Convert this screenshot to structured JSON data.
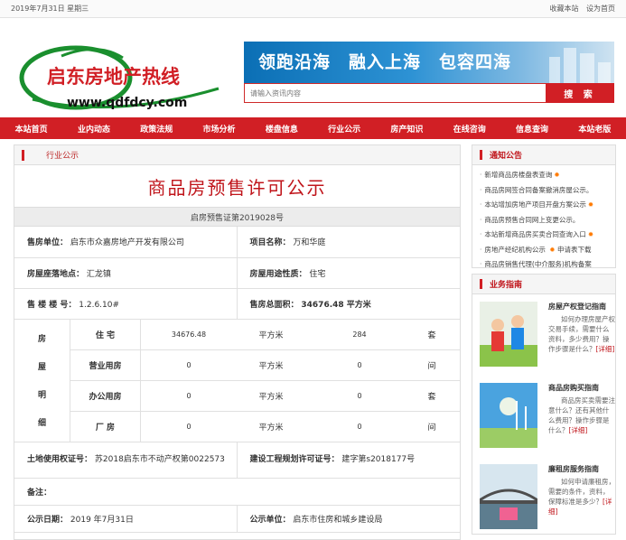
{
  "topbar": {
    "date": "2019年7月31日 星期三",
    "bookmark": "收藏本站",
    "homepage": "设为首页"
  },
  "header": {
    "logo_name": "启东房地产热线",
    "logo_url": "www.qdfdcy.com",
    "banner_slogan": "领跑沿海　融入上海　包容四海",
    "search_placeholder": "请输入资讯内容",
    "search_button": "搜  索"
  },
  "nav": [
    "本站首页",
    "业内动态",
    "政策法规",
    "市场分析",
    "楼盘信息",
    "行业公示",
    "房产知识",
    "在线咨询",
    "信息查询",
    "本站老版"
  ],
  "main": {
    "section": "行业公示",
    "title": "商品房预售许可公示",
    "cert_no": "启房预售证第2019028号",
    "seller_label": "售房单位：",
    "seller": "启东市众嘉房地产开发有限公司",
    "project_label": "项目名称：",
    "project": "万和华庭",
    "location_label": "房屋座落地点：",
    "location": "汇龙镇",
    "use_label": "房屋用途性质：",
    "use": "住宅",
    "building_label": "售 楼 楼 号：",
    "building": "1.2.6.10#",
    "area_label": "售房总面积：",
    "area": "34676.48 平方米",
    "detail_label": [
      "房",
      "屋",
      "明",
      "细"
    ],
    "detail_rows": [
      {
        "type": "住 宅",
        "area": "34676.48",
        "unit1": "平方米",
        "count": "284",
        "unit2": "套"
      },
      {
        "type": "营业用房",
        "area": "0",
        "unit1": "平方米",
        "count": "0",
        "unit2": "间"
      },
      {
        "type": "办公用房",
        "area": "0",
        "unit1": "平方米",
        "count": "0",
        "unit2": "套"
      },
      {
        "type": "厂 房",
        "area": "0",
        "unit1": "平方米",
        "count": "0",
        "unit2": "间"
      }
    ],
    "land_label": "土地使用权证号：",
    "land": "苏2018启东市不动产权第0022573",
    "plan_label": "建设工程规划许可证号：",
    "plan": "建字第s2018177号",
    "note_label": "备注：",
    "pubdate_label": "公示日期：",
    "pubdate": "2019 年7月31日",
    "pubunit_label": "公示单位：",
    "pubunit": "启东市住房和城乡建设局"
  },
  "sidebar": {
    "notice_title": "通知公告",
    "notices": [
      {
        "text": "新增商品房楼盘表查询",
        "hot": true
      },
      {
        "text": "商品房网签合同备案撤消房屋公示。",
        "hot": false
      },
      {
        "text": "本站增加房地产项目开盘方案公示",
        "hot": true
      },
      {
        "text": "商品房预售合同网上变更公示。",
        "hot": false
      },
      {
        "text": "本站新增商品房买卖合同查询入口",
        "hot": true
      },
      {
        "text": "房地产经纪机构公示 ",
        "hot": true,
        "extra": "申请表下载"
      },
      {
        "text": "商品房销售代理(中介服务)机构备案",
        "hot": false
      }
    ],
    "guide_title": "业务指南",
    "guides": [
      {
        "title": "房屋产权登记指南",
        "desc": "如何办理房屋产权交易手续，需要什么资料，多少费用？操作步骤是什么？",
        "more": "[详细]"
      },
      {
        "title": "商品房购买指南",
        "desc": "商品房买卖需要注意什么？还有其他什么费用？操作步骤是什么？",
        "more": "[详细]"
      },
      {
        "title": "廉租房服务指南",
        "desc": "如何申请廉租房，需要的条件，资料，保障标准是多少？",
        "more": "[详细]"
      }
    ]
  },
  "colors": {
    "brand_red": "#d11f25",
    "title_red": "#c0151b",
    "hot_star": "#ff7a00"
  }
}
